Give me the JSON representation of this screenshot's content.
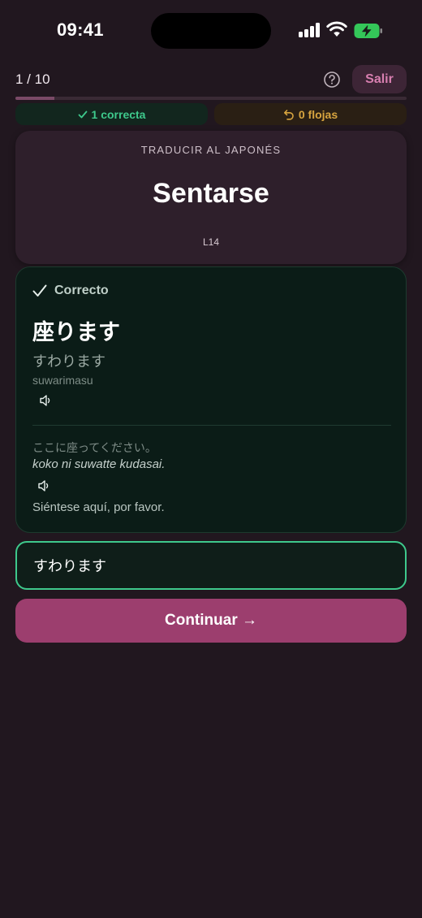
{
  "status_bar": {
    "time": "09:41"
  },
  "header": {
    "progress": "1 / 10",
    "progress_fraction": 0.1,
    "help_icon": "question-circle-icon",
    "exit_label": "Salir"
  },
  "counters": {
    "correct_label": "1 correcta",
    "correct_icon": "check-icon",
    "weak_label": "0 flojas",
    "weak_icon": "undo-icon"
  },
  "prompt": {
    "instruction": "TRADUCIR AL JAPONÉS",
    "word": "Sentarse",
    "lesson": "L14"
  },
  "result": {
    "status": "Correcto",
    "status_icon": "check-icon",
    "kanji": "座ります",
    "kana": "すわります",
    "romaji": "suwarimasu",
    "example_jp": "ここに座ってください。",
    "example_romaji": "koko ni suwatte kudasai.",
    "example_translation": "Siéntese aquí, por favor."
  },
  "answer": {
    "value": "すわります"
  },
  "continue_label": "Continuar →",
  "colors": {
    "background": "#21171f",
    "accent": "#9c3e6e",
    "correct": "#3ec98c",
    "weak": "#d7a43f"
  }
}
